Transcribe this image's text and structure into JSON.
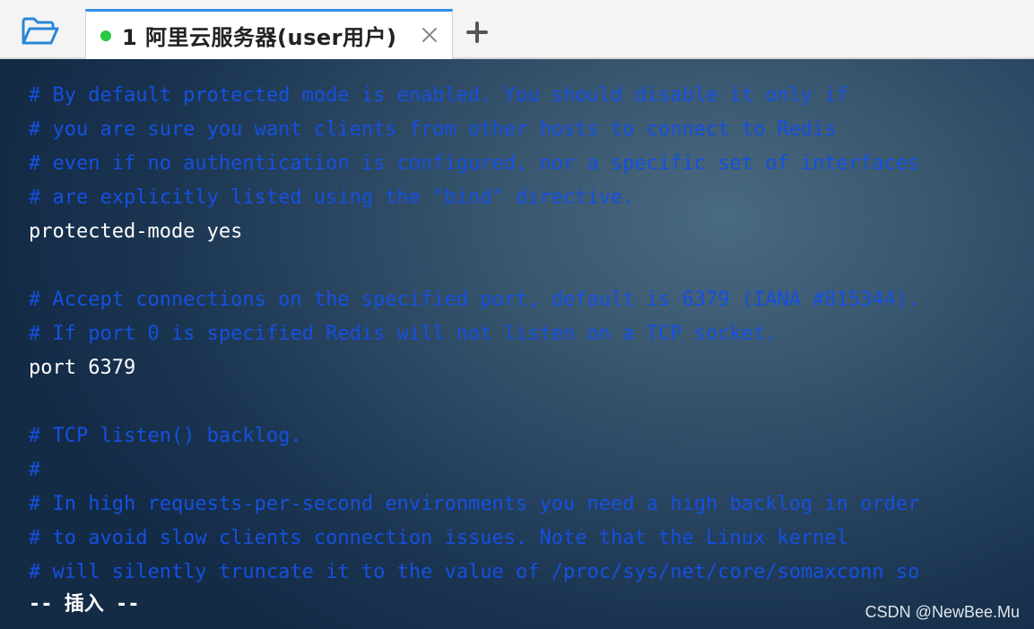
{
  "tabbar": {
    "folder_icon": "folder-open-icon",
    "tab": {
      "title": "1 阿里云服务器(user用户)",
      "status_color": "#28c840",
      "close_icon": "close-icon"
    },
    "add_icon": "plus-icon"
  },
  "terminal": {
    "lines": [
      {
        "type": "comment",
        "text": "# By default protected mode is enabled. You should disable it only if"
      },
      {
        "type": "comment",
        "text": "# you are sure you want clients from other hosts to connect to Redis"
      },
      {
        "type": "comment",
        "text": "# even if no authentication is configured, nor a specific set of interfaces"
      },
      {
        "type": "comment",
        "text": "# are explicitly listed using the \"bind\" directive."
      },
      {
        "type": "code",
        "text": "protected-mode yes"
      },
      {
        "type": "blank",
        "text": ""
      },
      {
        "type": "comment",
        "text": "# Accept connections on the specified port, default is 6379 (IANA #815344)."
      },
      {
        "type": "comment",
        "text": "# If port 0 is specified Redis will not listen on a TCP socket."
      },
      {
        "type": "code",
        "text": "port 6379"
      },
      {
        "type": "blank",
        "text": ""
      },
      {
        "type": "comment",
        "text": "# TCP listen() backlog."
      },
      {
        "type": "comment",
        "text": "#"
      },
      {
        "type": "comment",
        "text": "# In high requests-per-second environments you need a high backlog in order"
      },
      {
        "type": "comment",
        "text": "# to avoid slow clients connection issues. Note that the Linux kernel"
      },
      {
        "type": "comment",
        "text": "# will silently truncate it to the value of /proc/sys/net/core/somaxconn so"
      }
    ],
    "mode_indicator": "-- 插入 --",
    "comment_color": "#1550e0",
    "code_color": "#ffffff"
  },
  "watermark": "CSDN @NewBee.Mu"
}
